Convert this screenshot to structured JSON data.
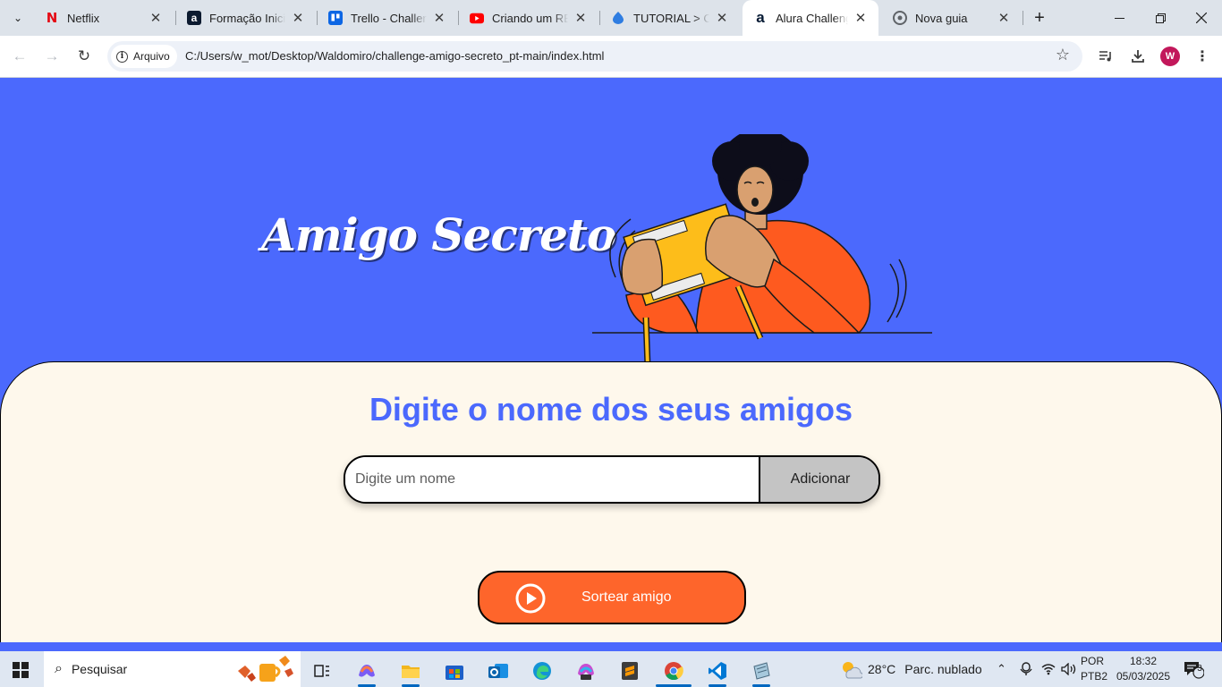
{
  "browser": {
    "tabs": [
      {
        "title": "Netflix",
        "favicon": "netflix-icon",
        "active": false
      },
      {
        "title": "Formação Iniciante",
        "favicon": "alura-icon",
        "active": false
      },
      {
        "title": "Trello - Challenge",
        "favicon": "trello-icon",
        "active": false
      },
      {
        "title": "Criando um README",
        "favicon": "youtube-icon",
        "active": false
      },
      {
        "title": "TUTORIAL > Criando",
        "favicon": "tutorial-icon",
        "active": false
      },
      {
        "title": "Alura Challenge",
        "favicon": "alura-icon",
        "active": true
      },
      {
        "title": "Nova guia",
        "favicon": "chrome-icon",
        "active": false
      }
    ],
    "address": {
      "security_label": "Arquivo",
      "url": "C:/Users/w_mot/Desktop/Waldomiro/challenge-amigo-secreto_pt-main/index.html"
    },
    "profile_initial": "W"
  },
  "page": {
    "hero_title": "Amigo Secreto",
    "section_title": "Digite o nome dos seus amigos",
    "input_placeholder": "Digite um nome",
    "input_value": "",
    "add_button": "Adicionar",
    "draw_button": "Sortear amigo",
    "colors": {
      "primary": "#4b69fd",
      "accent": "#fe652b",
      "card_bg": "#fef8ec",
      "button_gray": "#c4c4c4"
    }
  },
  "taskbar": {
    "search_placeholder": "Pesquisar",
    "weather": {
      "temp": "28°C",
      "condition": "Parc. nublado"
    },
    "language": {
      "line1": "POR",
      "line2": "PTB2"
    },
    "time": "18:32",
    "date": "05/03/2025",
    "notification_count": "3",
    "apps": [
      "task-view-icon",
      "copilot-icon",
      "file-explorer-icon",
      "microsoft-store-icon",
      "outlook-icon",
      "edge-icon",
      "m365-icon",
      "sublime-text-icon",
      "chrome-icon",
      "vscode-icon",
      "app-icon"
    ]
  }
}
